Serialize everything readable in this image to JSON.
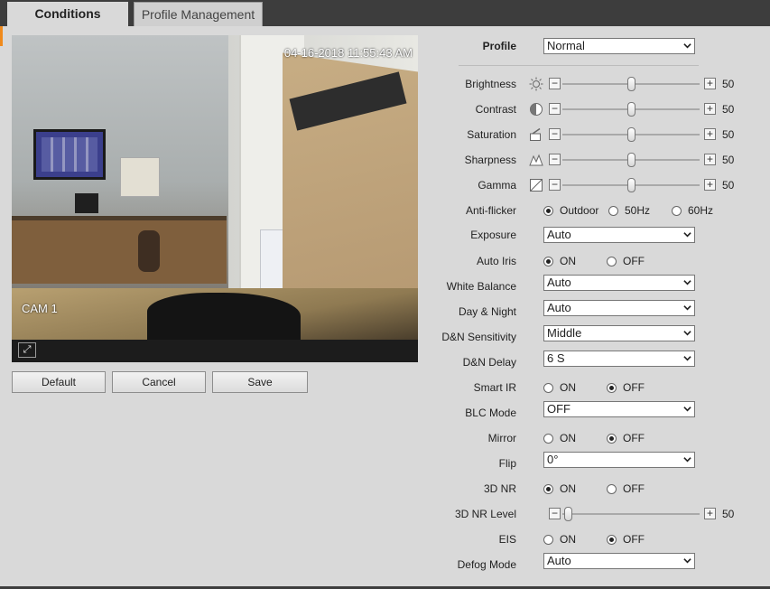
{
  "tabs": [
    {
      "label": "Conditions",
      "active": true
    },
    {
      "label": "Profile Management",
      "active": false
    }
  ],
  "video": {
    "timestamp": "04-16-2018 11:55:43 AM",
    "camera_label": "CAM 1",
    "fullscreen_icon": "fullscreen-icon"
  },
  "buttons": {
    "default": "Default",
    "cancel": "Cancel",
    "save": "Save"
  },
  "settings": {
    "profile": {
      "label": "Profile",
      "value": "Normal"
    },
    "brightness": {
      "label": "Brightness",
      "value": "50",
      "icon": "brightness-icon"
    },
    "contrast": {
      "label": "Contrast",
      "value": "50",
      "icon": "contrast-icon"
    },
    "saturation": {
      "label": "Saturation",
      "value": "50",
      "icon": "saturation-icon"
    },
    "sharpness": {
      "label": "Sharpness",
      "value": "50",
      "icon": "sharpness-icon"
    },
    "gamma": {
      "label": "Gamma",
      "value": "50",
      "icon": "gamma-icon"
    },
    "anti_flicker": {
      "label": "Anti-flicker",
      "options": [
        "Outdoor",
        "50Hz",
        "60Hz"
      ],
      "selected": "Outdoor"
    },
    "exposure": {
      "label": "Exposure",
      "value": "Auto"
    },
    "auto_iris": {
      "label": "Auto Iris",
      "options": [
        "ON",
        "OFF"
      ],
      "selected": "ON"
    },
    "white_balance": {
      "label": "White Balance",
      "value": "Auto"
    },
    "day_night": {
      "label": "Day & Night",
      "value": "Auto"
    },
    "dn_sensitivity": {
      "label": "D&N Sensitivity",
      "value": "Middle"
    },
    "dn_delay": {
      "label": "D&N Delay",
      "value": "6 S"
    },
    "smart_ir": {
      "label": "Smart IR",
      "options": [
        "ON",
        "OFF"
      ],
      "selected": "OFF"
    },
    "blc_mode": {
      "label": "BLC Mode",
      "value": "OFF"
    },
    "mirror": {
      "label": "Mirror",
      "options": [
        "ON",
        "OFF"
      ],
      "selected": "OFF"
    },
    "flip": {
      "label": "Flip",
      "value": "0°"
    },
    "nr_3d": {
      "label": "3D NR",
      "options": [
        "ON",
        "OFF"
      ],
      "selected": "ON"
    },
    "nr_3d_level": {
      "label": "3D NR Level",
      "value": "50"
    },
    "eis": {
      "label": "EIS",
      "options": [
        "ON",
        "OFF"
      ],
      "selected": "OFF"
    },
    "defog_mode": {
      "label": "Defog Mode",
      "value": "Auto"
    }
  },
  "colors": {
    "accent": "#f08a1c",
    "chrome": "#3d3d3d",
    "panel": "#d9d9d9"
  }
}
